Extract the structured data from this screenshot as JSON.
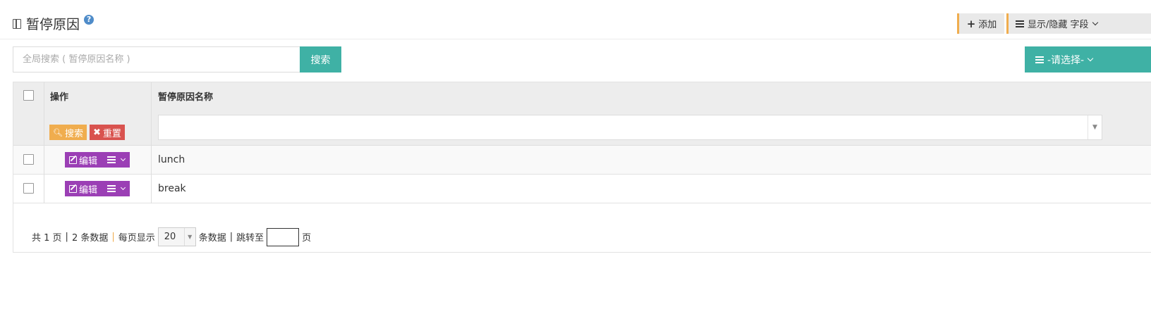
{
  "header": {
    "title": "暂停原因",
    "help_glyph": "?",
    "add_label": "添加",
    "fields_label": "显示/隐藏 字段"
  },
  "search": {
    "placeholder": "全局搜索 ( 暂停原因名称 )",
    "value": "",
    "button_label": "搜索",
    "select_label": "-请选择-"
  },
  "table": {
    "columns": [
      "操作",
      "暂停原因名称"
    ],
    "filter_search_label": "搜索",
    "filter_reset_label": "重置",
    "filter_value": "",
    "edit_label": "编辑",
    "rows": [
      {
        "name": "lunch",
        "checked": false
      },
      {
        "name": "break",
        "checked": false
      }
    ]
  },
  "pagination": {
    "total_pages_text": "共 1 页",
    "total_records_text": "2 条数据",
    "per_page_label": "每页显示",
    "page_size": "20",
    "per_page_suffix": "条数据",
    "jump_label": "跳转至",
    "jump_value": "",
    "page_suffix": "页"
  },
  "colors": {
    "accent_teal": "#3fb1a5",
    "edit_purple": "#9b3fb5",
    "search_orange": "#f0ad4e",
    "reset_red": "#d9534f"
  }
}
